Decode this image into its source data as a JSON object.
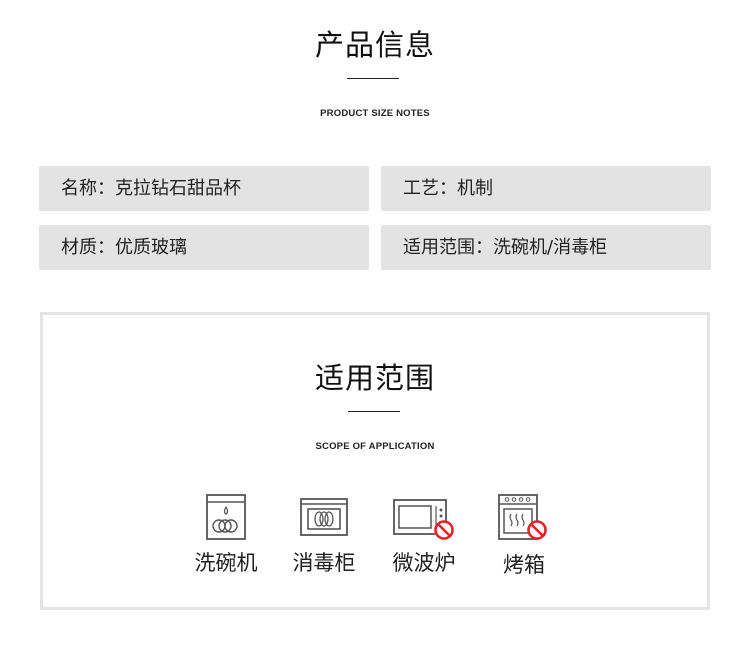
{
  "product_info": {
    "title": "产品信息",
    "subtitle": "PRODUCT SIZE NOTES",
    "items": [
      "名称：克拉钻石甜品杯",
      "工艺：机制",
      "材质：优质玻璃",
      "适用范围：洗碗机/消毒柜"
    ]
  },
  "scope": {
    "title": "适用范围",
    "subtitle": "SCOPE OF APPLICATION",
    "apps": [
      {
        "label": "洗碗机",
        "icon": "dishwasher-icon",
        "allowed": true
      },
      {
        "label": "消毒柜",
        "icon": "sterilizer-cabinet-icon",
        "allowed": true
      },
      {
        "label": "微波炉",
        "icon": "microwave-icon",
        "allowed": false
      },
      {
        "label": "烤箱",
        "icon": "oven-icon",
        "allowed": false
      }
    ]
  },
  "colors": {
    "info_box_bg": "#e3e3e3",
    "prohibited_red": "#e8202a",
    "panel_border": "#e4e4e4"
  }
}
